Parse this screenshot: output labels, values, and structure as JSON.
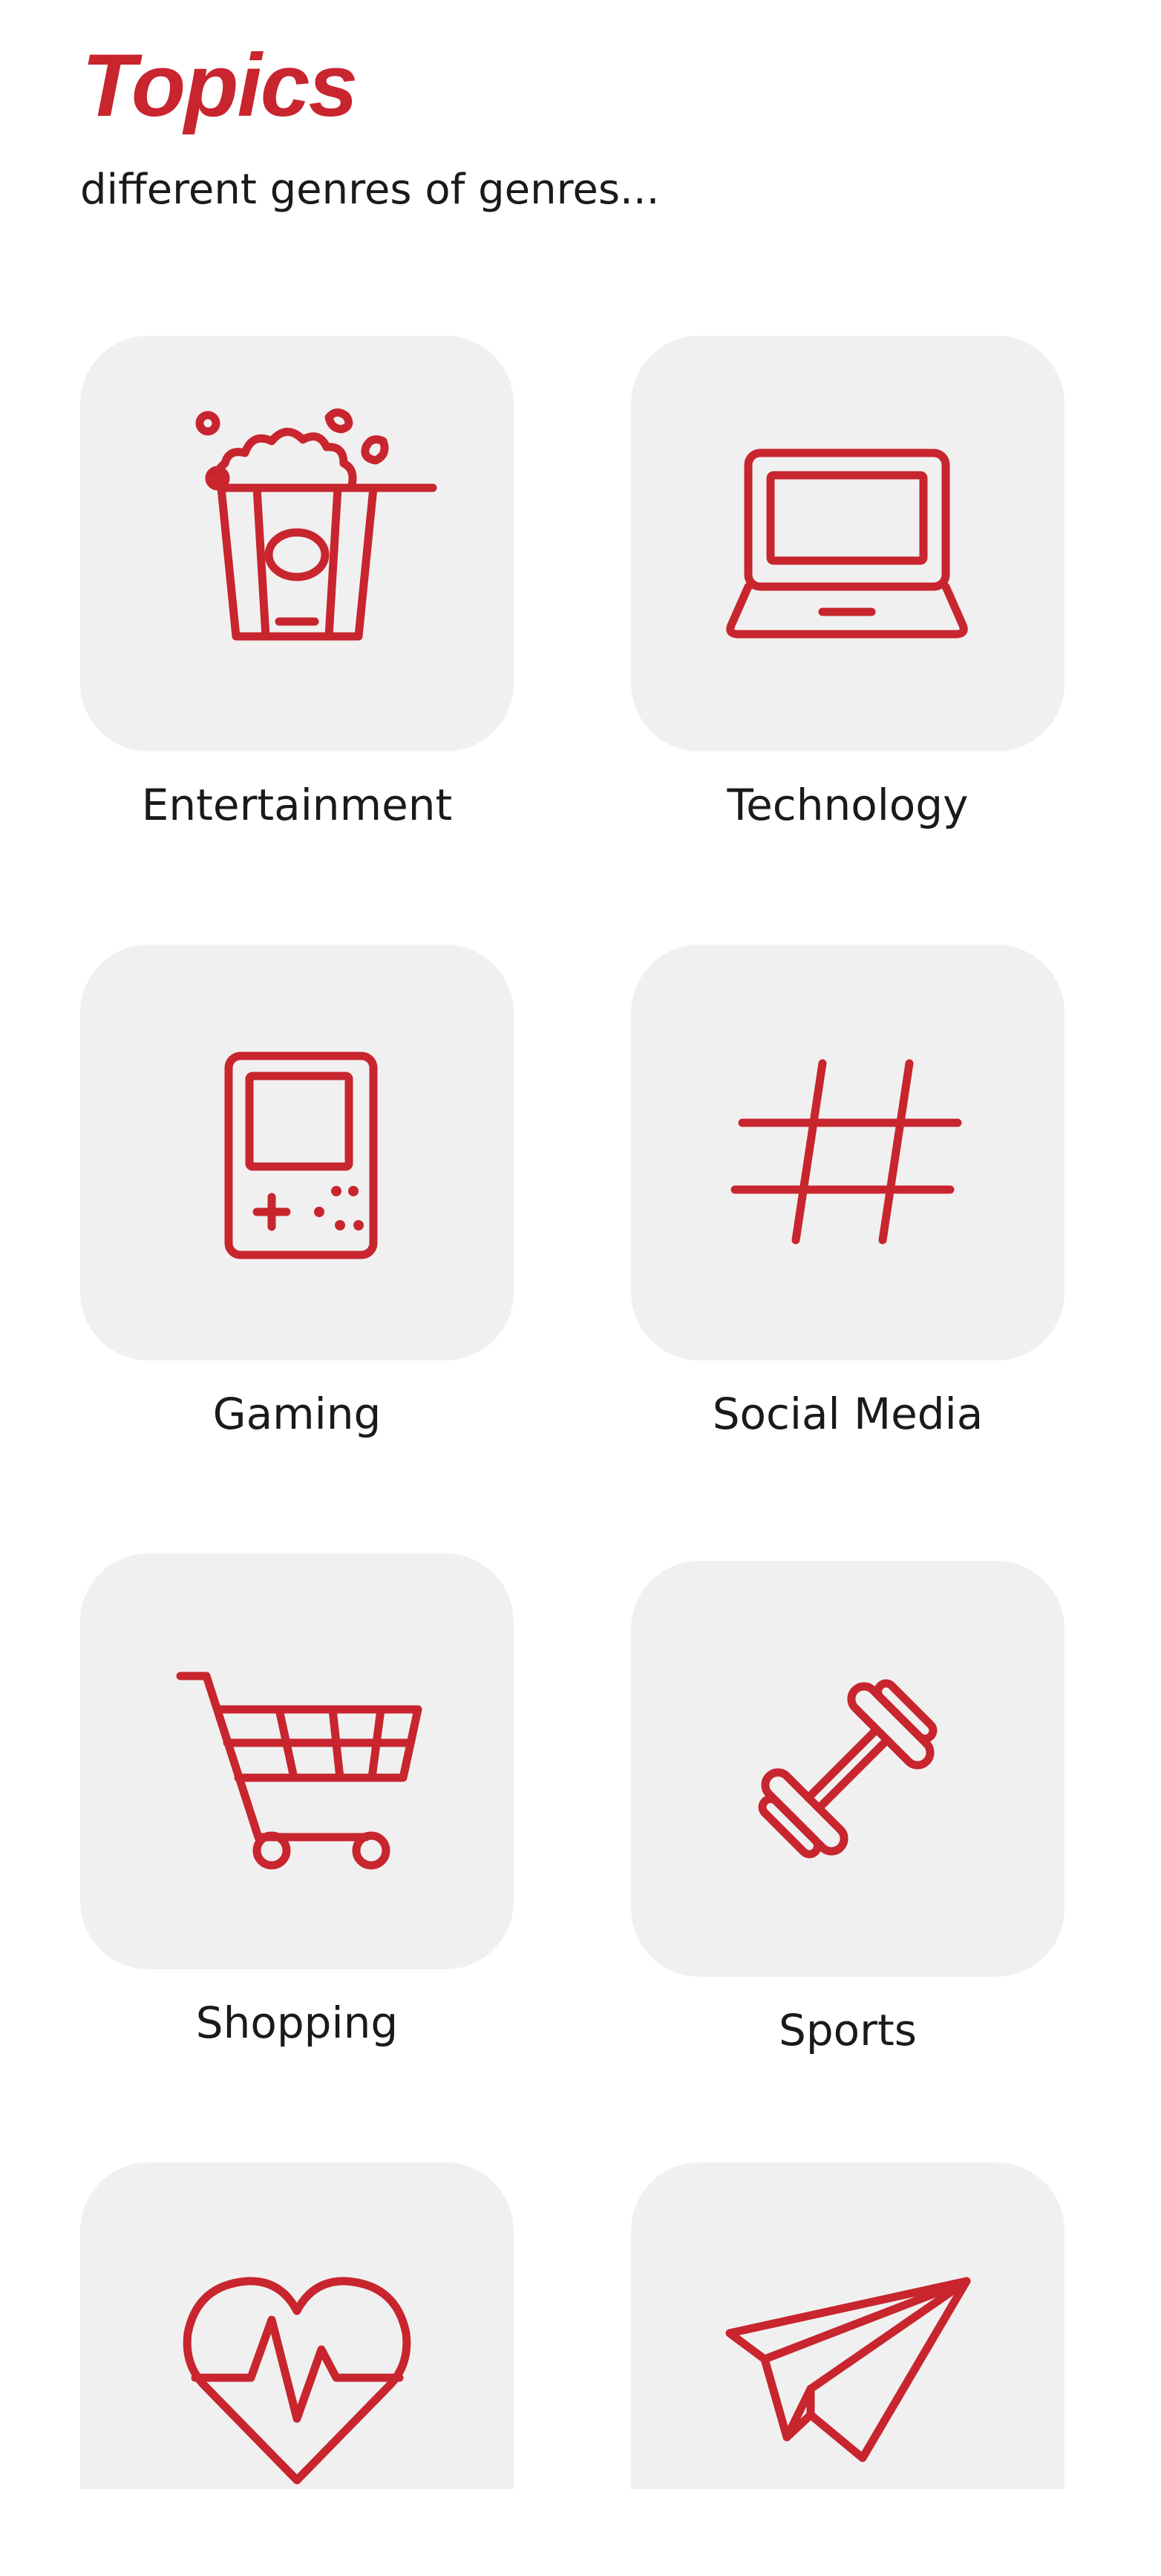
{
  "header": {
    "title": "Topics",
    "subtitle": "different genres of genres..."
  },
  "topics": [
    {
      "label": "Entertainment",
      "icon": "popcorn-icon"
    },
    {
      "label": "Technology",
      "icon": "laptop-icon"
    },
    {
      "label": "Gaming",
      "icon": "handheld-console-icon"
    },
    {
      "label": "Social Media",
      "icon": "hashtag-icon"
    },
    {
      "label": "Shopping",
      "icon": "shopping-cart-icon"
    },
    {
      "label": "Sports",
      "icon": "dumbbell-icon"
    },
    {
      "label": "",
      "icon": "heartbeat-icon"
    },
    {
      "label": "",
      "icon": "paper-plane-icon"
    }
  ],
  "colors": {
    "accent": "#c8252e",
    "tile_background": "#f1f0f0",
    "text": "#1a1a1a",
    "background": "#ffffff"
  }
}
